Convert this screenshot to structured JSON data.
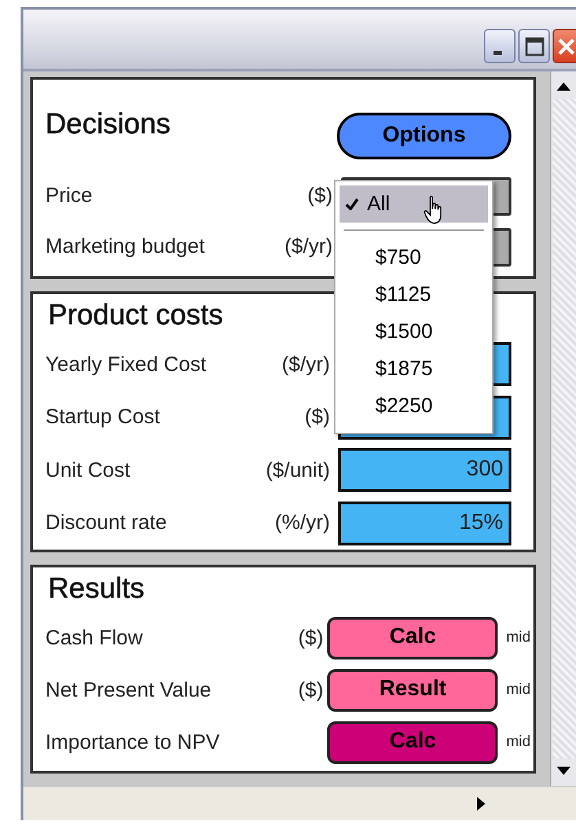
{
  "decisions": {
    "title": "Decisions",
    "button": "Options",
    "rows": [
      {
        "label": "Price",
        "unit": "($)"
      },
      {
        "label": "Marketing budget",
        "unit": "($/yr)"
      }
    ]
  },
  "price_menu": {
    "items": [
      {
        "label": "All",
        "selected": true
      },
      {
        "label": "$750",
        "selected": false
      },
      {
        "label": "$1125",
        "selected": false
      },
      {
        "label": "$1500",
        "selected": false
      },
      {
        "label": "$1875",
        "selected": false
      },
      {
        "label": "$2250",
        "selected": false
      }
    ]
  },
  "product_costs": {
    "title": "Product costs",
    "rows": [
      {
        "label": "Yearly Fixed Cost",
        "unit": "($/yr)"
      },
      {
        "label": "Startup Cost",
        "unit": "($)"
      },
      {
        "label": "Unit Cost",
        "unit": "($/unit)",
        "value": "300"
      },
      {
        "label": "Discount rate",
        "unit": "(%/yr)",
        "value": "15%"
      }
    ]
  },
  "results": {
    "title": "Results",
    "rows": [
      {
        "label": "Cash Flow",
        "unit": "($)",
        "button": "Calc",
        "color": "#ff6699",
        "suffix": "mid"
      },
      {
        "label": "Net Present Value",
        "unit": "($)",
        "button": "Result",
        "color": "#ff6699",
        "suffix": "mid"
      },
      {
        "label": "Importance to NPV",
        "button": "Calc",
        "color": "#cc0077",
        "suffix": "mid"
      }
    ]
  }
}
